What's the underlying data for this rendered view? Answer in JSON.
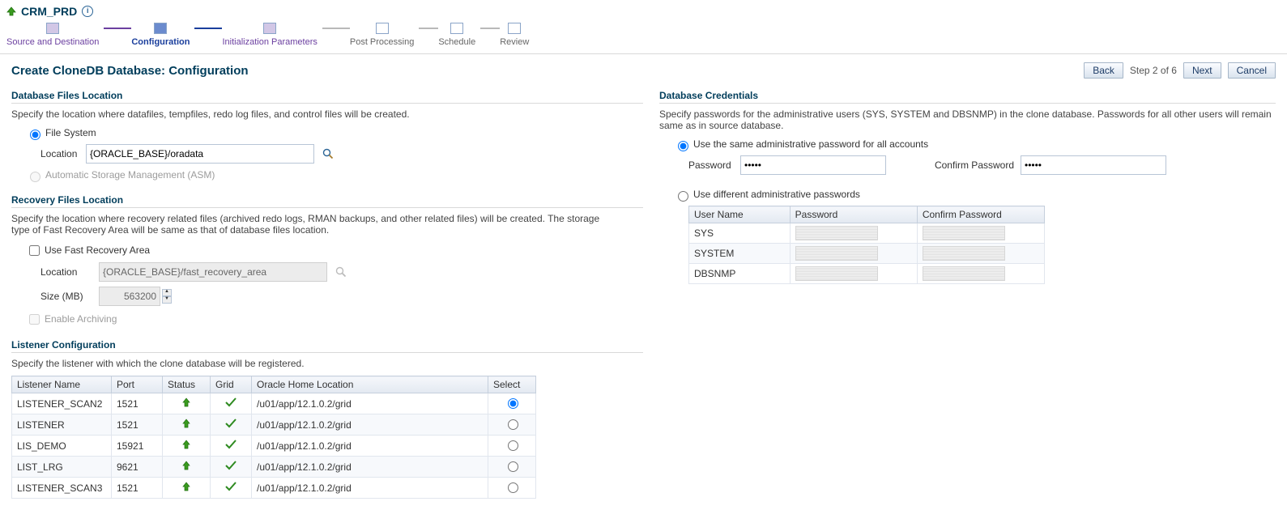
{
  "header": {
    "title": "CRM_PRD"
  },
  "wizard": {
    "steps": [
      {
        "label": "Source and Destination",
        "state": "done"
      },
      {
        "label": "Configuration",
        "state": "cur"
      },
      {
        "label": "Initialization Parameters",
        "state": "done"
      },
      {
        "label": "Post Processing",
        "state": "todo"
      },
      {
        "label": "Schedule",
        "state": "todo"
      },
      {
        "label": "Review",
        "state": "todo"
      }
    ]
  },
  "page": {
    "title": "Create CloneDB Database: Configuration"
  },
  "nav": {
    "back": "Back",
    "next": "Next",
    "cancel": "Cancel",
    "step_of": "Step 2 of 6"
  },
  "left": {
    "dbfiles": {
      "heading": "Database Files Location",
      "desc": "Specify the location where datafiles, tempfiles, redo log files, and control files will be created.",
      "opt_fs": "File System",
      "location_lbl": "Location",
      "location_val": "{ORACLE_BASE}/oradata",
      "opt_asm": "Automatic Storage Management (ASM)"
    },
    "recovery": {
      "heading": "Recovery Files Location",
      "desc": "Specify the location where recovery related files (archived redo logs, RMAN backups, and other related files) will be created. The storage type of Fast Recovery Area will be same as that of database files location.",
      "use_fra": "Use Fast Recovery Area",
      "location_lbl": "Location",
      "location_val": "{ORACLE_BASE}/fast_recovery_area",
      "size_lbl": "Size (MB)",
      "size_val": "563200",
      "enable_arch": "Enable Archiving"
    },
    "listener": {
      "heading": "Listener Configuration",
      "desc": "Specify the listener with which the clone database will be registered.",
      "cols": {
        "name": "Listener Name",
        "port": "Port",
        "status": "Status",
        "grid": "Grid",
        "home": "Oracle Home Location",
        "select": "Select"
      },
      "rows": [
        {
          "name": "LISTENER_SCAN2",
          "port": "1521",
          "home": "/u01/app/12.1.0.2/grid",
          "selected": true
        },
        {
          "name": "LISTENER",
          "port": "1521",
          "home": "/u01/app/12.1.0.2/grid",
          "selected": false
        },
        {
          "name": "LIS_DEMO",
          "port": "15921",
          "home": "/u01/app/12.1.0.2/grid",
          "selected": false
        },
        {
          "name": "LIST_LRG",
          "port": "9621",
          "home": "/u01/app/12.1.0.2/grid",
          "selected": false
        },
        {
          "name": "LISTENER_SCAN3",
          "port": "1521",
          "home": "/u01/app/12.1.0.2/grid",
          "selected": false
        }
      ]
    }
  },
  "right": {
    "cred": {
      "heading": "Database Credentials",
      "desc": "Specify passwords for the administrative users (SYS, SYSTEM and DBSNMP) in the clone database. Passwords for all other users will remain same as in source database.",
      "opt_same": "Use the same administrative password for all accounts",
      "pwd_lbl": "Password",
      "pwd_val": "•••••",
      "cpwd_lbl": "Confirm Password",
      "cpwd_val": "•••••",
      "opt_diff": "Use different administrative passwords",
      "cols": {
        "user": "User Name",
        "pwd": "Password",
        "cpwd": "Confirm Password"
      },
      "rows": [
        {
          "user": "SYS"
        },
        {
          "user": "SYSTEM"
        },
        {
          "user": "DBSNMP"
        }
      ]
    }
  }
}
